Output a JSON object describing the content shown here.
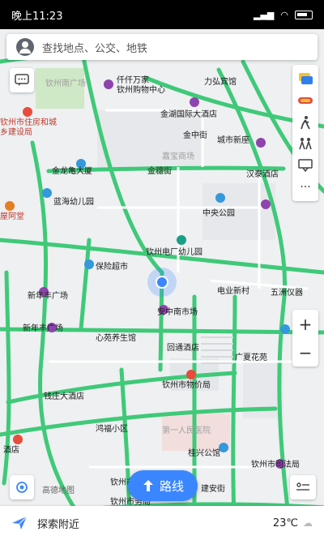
{
  "status": {
    "time": "晚上11:23"
  },
  "search": {
    "placeholder": "查找地点、公交、地铁"
  },
  "buttons": {
    "route_label": "路线"
  },
  "bottom": {
    "nearby_label": "探索附近",
    "temperature": "23℃"
  },
  "logo": {
    "text": "高德地图"
  },
  "icons": {
    "search_avatar": "avatar-icon",
    "message": "message-icon",
    "traffic": "traffic-icon",
    "bus": "bus-icon",
    "walk": "walk-icon",
    "group": "group-icon",
    "report": "report-icon",
    "more": "more-icon",
    "locate": "locate-icon",
    "layers": "layers-icon",
    "route": "route-icon",
    "nearby": "paper-plane-icon"
  },
  "colors": {
    "accent": "#3a86ff",
    "road": "#3fc978"
  },
  "map_labels": [
    "钦州南广场",
    "仟仟万家",
    "钦州购物中心",
    "力弘宾馆",
    "金湖国际大酒店",
    "钦州市住房和城乡建设局",
    "金中街",
    "城市新座",
    "嘉宝商场",
    "金龙亀大厦",
    "金穗街",
    "汉泰酒店",
    "蓝海幼儿园",
    "中央公园",
    "钦州电厂幼儿园",
    "保险超市",
    "新年丰广场",
    "新年丰广场",
    "安中南市场",
    "电业新村",
    "五洲仪器",
    "心苑养生馆",
    "回通酒店",
    "广夏花苑",
    "钦州市物价局",
    "钱庄大酒店",
    "鸿福小区",
    "第一人民医院",
    "桂兴公馆",
    "钦州市司法局",
    "钦州市商局",
    "钦州市务局",
    "屋阿堂",
    "酒店",
    "建安街"
  ]
}
